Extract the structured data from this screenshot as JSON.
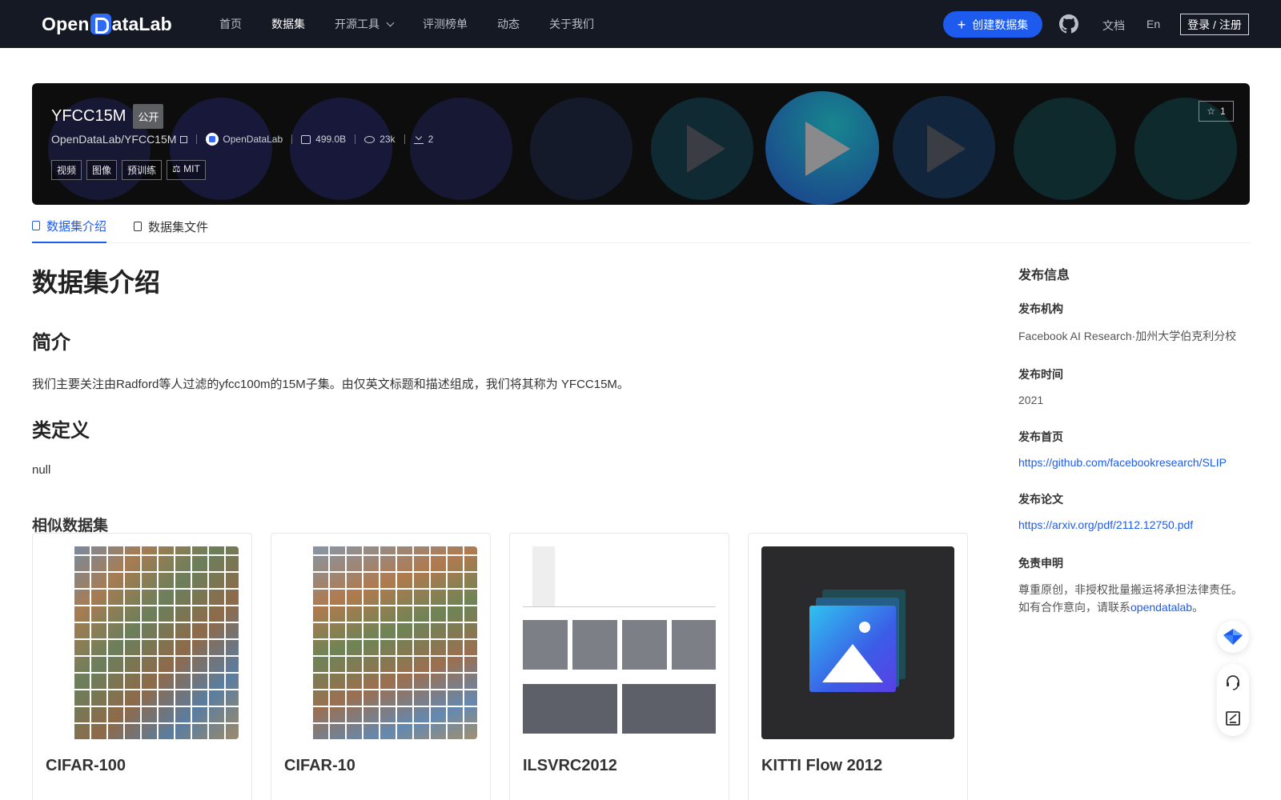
{
  "nav": {
    "logo_text": "OpenDataLab",
    "links": [
      "首页",
      "数据集",
      "开源工具",
      "评测榜单",
      "动态",
      "关于我们"
    ],
    "create_label": "创建数据集",
    "docs_label": "文档",
    "lang_label": "En",
    "login_label": "登录 / 注册"
  },
  "dataset": {
    "name": "YFCC15M",
    "visibility": "公开",
    "path": "OpenDataLab/YFCC15M",
    "org": "OpenDataLab",
    "size": "499.0B",
    "views": "23k",
    "downloads": "2",
    "tags": [
      "视频",
      "图像",
      "预训练",
      "MIT"
    ],
    "stars": "1"
  },
  "tabs": [
    "数据集介绍",
    "数据集文件"
  ],
  "intro": {
    "title": "数据集介绍",
    "summary_heading": "简介",
    "summary_text": "我们主要关注由Radford等人过滤的yfcc100m的15M子集。由仅英文标题和描述组成，我们将其称为 YFCC15M。",
    "classes_heading": "类定义",
    "classes_text": "null",
    "similar_heading": "相似数据集"
  },
  "similar": [
    {
      "name": "CIFAR-100"
    },
    {
      "name": "CIFAR-10"
    },
    {
      "name": "ILSVRC2012"
    },
    {
      "name": "KITTI Flow 2012"
    }
  ],
  "side": {
    "title": "发布信息",
    "org_label": "发布机构",
    "org_value": "Facebook AI Research·加州大学伯克利分校",
    "time_label": "发布时间",
    "time_value": "2021",
    "home_label": "发布首页",
    "home_value": "https://github.com/facebookresearch/SLIP",
    "paper_label": "发布论文",
    "paper_value": "https://arxiv.org/pdf/2112.12750.pdf",
    "disclaimer_label": "免责申明",
    "disclaimer_text_1": "尊重原创，非授权批量搬运将承担法律责任。",
    "disclaimer_text_2": "如有合作意向，请联系",
    "disclaimer_link": "opendatalab",
    "disclaimer_text_3": "。"
  },
  "icons": {
    "github": "github-icon",
    "star": "star-icon",
    "license": "scale-icon",
    "float_top": "diamond-icon",
    "float_mid": "headset-icon",
    "float_bot": "edit-icon"
  },
  "colors": {
    "accent": "#1d5bef",
    "nav_bg": "#141924",
    "banner_bg": "#0d0d0e"
  }
}
